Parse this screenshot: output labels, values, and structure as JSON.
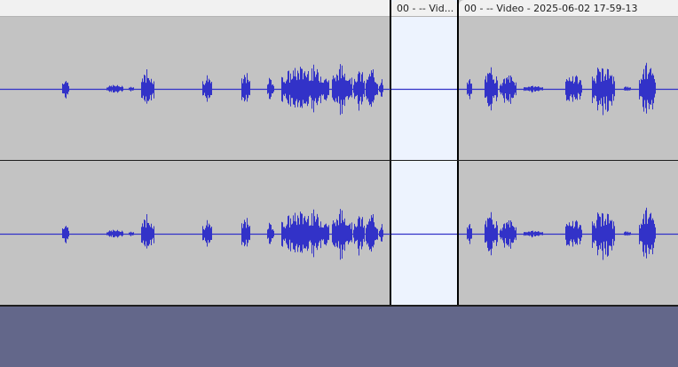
{
  "colors": {
    "waveform": "#3232c8",
    "clip_background": "#c3c3c3",
    "selected_background": "#edf3fe",
    "header_background": "#f1f1f1",
    "empty_background": "#63678a"
  },
  "clips": [
    {
      "title": "",
      "selected": false
    },
    {
      "title": "00 - -- Vid...",
      "selected": true
    },
    {
      "title": "00 - -- Video - 2025-06-02 17-59-13",
      "selected": false
    }
  ]
}
